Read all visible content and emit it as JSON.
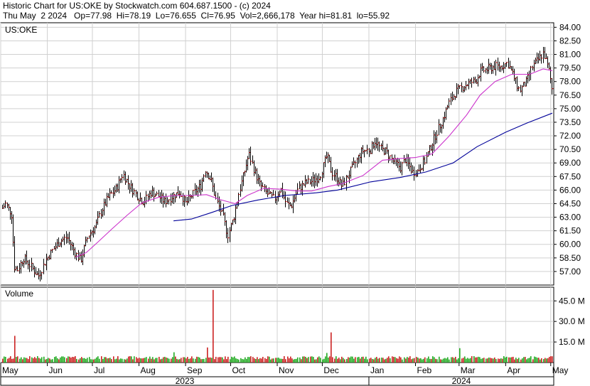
{
  "header": {
    "line1": "Historic Chart for US:OKE by Stockwatch.com 604.687.1500 - (c) 2024",
    "line2": "Thu May  2 2024   Op=77.98  Hi=78.19  Lo=76.655  Cl=76.95  Vol=2,666,178  Year hi=81.81  lo=55.92"
  },
  "colors": {
    "bar": "#000000",
    "bar_tick": "#cc0000",
    "ma_short": "#cc33cc",
    "ma_long": "#000099",
    "vol_up": "#22aa22",
    "vol_down": "#cc2222",
    "grid": "#d0d0d0"
  },
  "chart_data": {
    "type": "ohlc",
    "symbol_label": "US:OKE",
    "price_axis": {
      "min": 55.5,
      "max": 84.5,
      "ticks": [
        "84.00",
        "82.50",
        "81.00",
        "79.50",
        "78.00",
        "76.50",
        "75.00",
        "73.50",
        "72.00",
        "70.50",
        "69.00",
        "67.50",
        "66.00",
        "64.50",
        "63.00",
        "61.50",
        "60.00",
        "58.50",
        "57.00"
      ]
    },
    "volume_panel": {
      "label": "Volume",
      "max_millions": 55,
      "ticks": [
        "45.0 M",
        "30.0 M",
        "15.0 M"
      ]
    },
    "months": [
      "May",
      "Jun",
      "Jul",
      "Aug",
      "Sep",
      "Oct",
      "Nov",
      "Dec",
      "Jan",
      "Feb",
      "Mar",
      "Apr",
      "May"
    ],
    "years": [
      "2023",
      "2024"
    ],
    "price_path": [
      [
        "2023-05-02",
        64.0
      ],
      [
        "2023-05-04",
        64.5
      ],
      [
        "2023-05-08",
        63.4
      ],
      [
        "2023-05-10",
        57.5
      ],
      [
        "2023-05-12",
        57.2
      ],
      [
        "2023-05-16",
        58.5
      ],
      [
        "2023-05-19",
        58.0
      ],
      [
        "2023-05-24",
        56.9
      ],
      [
        "2023-05-26",
        56.5
      ],
      [
        "2023-05-31",
        58.3
      ],
      [
        "2023-06-05",
        59.5
      ],
      [
        "2023-06-09",
        60.3
      ],
      [
        "2023-06-14",
        60.8
      ],
      [
        "2023-06-19",
        59.2
      ],
      [
        "2023-06-23",
        58.2
      ],
      [
        "2023-06-28",
        61.0
      ],
      [
        "2023-07-03",
        62.0
      ],
      [
        "2023-07-07",
        63.8
      ],
      [
        "2023-07-12",
        65.3
      ],
      [
        "2023-07-17",
        66.2
      ],
      [
        "2023-07-21",
        67.8
      ],
      [
        "2023-07-26",
        66.4
      ],
      [
        "2023-07-31",
        65.3
      ],
      [
        "2023-08-04",
        64.7
      ],
      [
        "2023-08-09",
        65.8
      ],
      [
        "2023-08-14",
        65.3
      ],
      [
        "2023-08-18",
        64.7
      ],
      [
        "2023-08-23",
        65.3
      ],
      [
        "2023-08-28",
        65.8
      ],
      [
        "2023-09-01",
        64.5
      ],
      [
        "2023-09-06",
        65.6
      ],
      [
        "2023-09-11",
        66.5
      ],
      [
        "2023-09-14",
        68.3
      ],
      [
        "2023-09-18",
        67.0
      ],
      [
        "2023-09-21",
        65.0
      ],
      [
        "2023-09-26",
        63.0
      ],
      [
        "2023-09-29",
        61.0
      ],
      [
        "2023-10-03",
        63.0
      ],
      [
        "2023-10-06",
        65.5
      ],
      [
        "2023-10-10",
        68.0
      ],
      [
        "2023-10-13",
        70.0
      ],
      [
        "2023-10-17",
        68.0
      ],
      [
        "2023-10-20",
        66.7
      ],
      [
        "2023-10-25",
        65.6
      ],
      [
        "2023-10-30",
        65.0
      ],
      [
        "2023-11-03",
        66.2
      ],
      [
        "2023-11-07",
        64.5
      ],
      [
        "2023-11-10",
        64.2
      ],
      [
        "2023-11-15",
        66.2
      ],
      [
        "2023-11-20",
        66.8
      ],
      [
        "2023-11-24",
        67.0
      ],
      [
        "2023-11-29",
        67.5
      ],
      [
        "2023-12-04",
        69.8
      ],
      [
        "2023-12-07",
        68.0
      ],
      [
        "2023-12-11",
        67.3
      ],
      [
        "2023-12-14",
        66.4
      ],
      [
        "2023-12-18",
        67.6
      ],
      [
        "2023-12-21",
        68.5
      ],
      [
        "2023-12-27",
        70.3
      ],
      [
        "2024-01-02",
        70.5
      ],
      [
        "2024-01-05",
        71.5
      ],
      [
        "2024-01-09",
        70.5
      ],
      [
        "2024-01-12",
        70.3
      ],
      [
        "2024-01-17",
        69.2
      ],
      [
        "2024-01-22",
        68.5
      ],
      [
        "2024-01-25",
        69.4
      ],
      [
        "2024-01-30",
        68.0
      ],
      [
        "2024-02-02",
        68.1
      ],
      [
        "2024-02-07",
        69.2
      ],
      [
        "2024-02-12",
        71.2
      ],
      [
        "2024-02-15",
        72.4
      ],
      [
        "2024-02-20",
        74.2
      ],
      [
        "2024-02-23",
        75.6
      ],
      [
        "2024-02-28",
        76.9
      ],
      [
        "2024-03-04",
        77.5
      ],
      [
        "2024-03-07",
        77.8
      ],
      [
        "2024-03-12",
        78.1
      ],
      [
        "2024-03-15",
        79.1
      ],
      [
        "2024-03-20",
        79.4
      ],
      [
        "2024-03-25",
        79.7
      ],
      [
        "2024-03-28",
        79.6
      ],
      [
        "2024-04-02",
        80.1
      ],
      [
        "2024-04-05",
        79.0
      ],
      [
        "2024-04-10",
        77.0
      ],
      [
        "2024-04-15",
        78.0
      ],
      [
        "2024-04-18",
        79.5
      ],
      [
        "2024-04-23",
        80.5
      ],
      [
        "2024-04-26",
        81.2
      ],
      [
        "2024-04-30",
        79.0
      ],
      [
        "2024-05-02",
        76.95
      ]
    ],
    "ma_short_path": [
      [
        "2023-06-20",
        58.6
      ],
      [
        "2023-06-27",
        59.1
      ],
      [
        "2023-07-05",
        60.3
      ],
      [
        "2023-07-14",
        61.7
      ],
      [
        "2023-07-24",
        63.2
      ],
      [
        "2023-08-03",
        64.6
      ],
      [
        "2023-08-14",
        65.2
      ],
      [
        "2023-08-25",
        65.4
      ],
      [
        "2023-09-05",
        65.4
      ],
      [
        "2023-09-15",
        65.5
      ],
      [
        "2023-09-25",
        64.9
      ],
      [
        "2023-10-04",
        64.5
      ],
      [
        "2023-10-12",
        65.4
      ],
      [
        "2023-10-23",
        66.2
      ],
      [
        "2023-11-03",
        66.1
      ],
      [
        "2023-11-14",
        65.9
      ],
      [
        "2023-11-24",
        65.9
      ],
      [
        "2023-12-05",
        66.4
      ],
      [
        "2023-12-14",
        66.7
      ],
      [
        "2023-12-28",
        67.6
      ],
      [
        "2024-01-10",
        69.3
      ],
      [
        "2024-01-22",
        69.5
      ],
      [
        "2024-02-01",
        69.6
      ],
      [
        "2024-02-12",
        70.0
      ],
      [
        "2024-02-23",
        71.9
      ],
      [
        "2024-03-06",
        74.3
      ],
      [
        "2024-03-15",
        76.5
      ],
      [
        "2024-03-25",
        78.0
      ],
      [
        "2024-04-05",
        78.8
      ],
      [
        "2024-04-17",
        78.8
      ],
      [
        "2024-04-26",
        79.4
      ],
      [
        "2024-05-02",
        79.2
      ]
    ],
    "ma_long_path": [
      [
        "2023-08-24",
        62.6
      ],
      [
        "2023-09-05",
        62.8
      ],
      [
        "2023-09-18",
        63.5
      ],
      [
        "2023-10-02",
        64.3
      ],
      [
        "2023-10-19",
        64.9
      ],
      [
        "2023-11-06",
        65.4
      ],
      [
        "2023-11-27",
        65.7
      ],
      [
        "2023-12-11",
        66.0
      ],
      [
        "2024-01-02",
        66.9
      ],
      [
        "2024-01-22",
        67.4
      ],
      [
        "2024-02-08",
        68.0
      ],
      [
        "2024-02-26",
        69.0
      ],
      [
        "2024-03-13",
        70.8
      ],
      [
        "2024-04-01",
        72.4
      ],
      [
        "2024-04-15",
        73.4
      ],
      [
        "2024-05-02",
        74.5
      ]
    ],
    "volume_spikes": [
      [
        "2023-05-10",
        19.5
      ],
      [
        "2023-09-19",
        53.0
      ],
      [
        "2023-09-15",
        11.0
      ],
      [
        "2023-08-24",
        7.5
      ],
      [
        "2023-12-04",
        7.0
      ],
      [
        "2023-12-07",
        22.0
      ],
      [
        "2024-03-01",
        10.5
      ],
      [
        "2024-03-15",
        4.0
      ]
    ]
  }
}
